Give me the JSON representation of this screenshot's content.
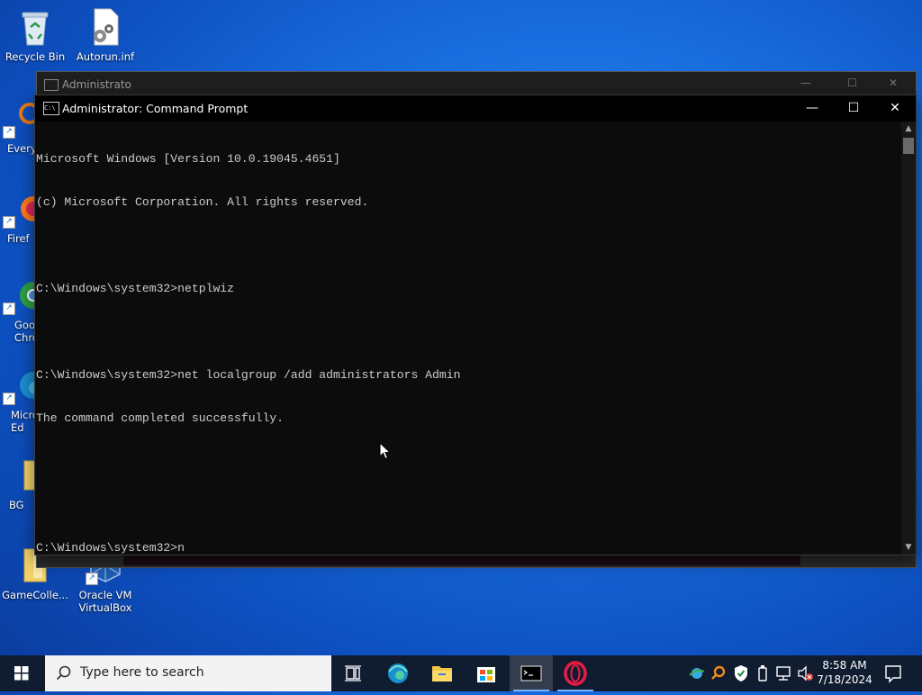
{
  "desktop": {
    "icons": [
      {
        "label": "Recycle Bin"
      },
      {
        "label": "Autorun.inf"
      },
      {
        "label": "Every"
      },
      {
        "label": "Firef"
      },
      {
        "label": "Goo Chro"
      },
      {
        "label": "Micro Ed"
      },
      {
        "label": "BG"
      },
      {
        "label": "GameColle..."
      },
      {
        "label": "Oracle VM VirtualBox"
      }
    ]
  },
  "background_window": {
    "title": "Administrato"
  },
  "cmd_window": {
    "title": "Administrator: Command Prompt",
    "icon_label": "C:\\",
    "lines": [
      "Microsoft Windows [Version 10.0.19045.4651]",
      "(c) Microsoft Corporation. All rights reserved.",
      "",
      "C:\\Windows\\system32>netplwiz",
      "",
      "C:\\Windows\\system32>net localgroup /add administrators Admin",
      "The command completed successfully.",
      "",
      "",
      "C:\\Windows\\system32>n"
    ],
    "controls": {
      "minimize": "—",
      "maximize": "☐",
      "close": "✕"
    }
  },
  "taskbar": {
    "search_placeholder": "Type here to search",
    "apps": [
      {
        "name": "task-view-icon"
      },
      {
        "name": "edge-icon"
      },
      {
        "name": "file-explorer-icon"
      },
      {
        "name": "store-icon"
      },
      {
        "name": "command-prompt-icon"
      },
      {
        "name": "opera-icon"
      }
    ],
    "clock": {
      "time": "8:58 AM",
      "date": "7/18/2024"
    }
  },
  "colors": {
    "desktop_blue": "#1a6fe0",
    "terminal_bg": "#0c0c0c",
    "terminal_fg": "#cccccc",
    "taskbar_bg": "#101c30"
  }
}
